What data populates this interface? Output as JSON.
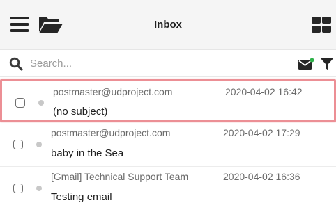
{
  "header": {
    "title": "Inbox",
    "menu_icon": "hamburger-menu-icon",
    "folder_icon": "folder-open-icon",
    "layout_icon": "grid-view-icon"
  },
  "search": {
    "placeholder": "Search...",
    "value": "",
    "search_icon": "search-icon",
    "mail_icon": "mail-unread-icon",
    "filter_icon": "filter-icon"
  },
  "messages": [
    {
      "sender": "postmaster@udproject.com",
      "date": "2020-04-02 16:42",
      "subject": "(no subject)",
      "highlighted": true
    },
    {
      "sender": "postmaster@udproject.com",
      "date": "2020-04-02 17:29",
      "subject": "baby in the Sea",
      "highlighted": false
    },
    {
      "sender": "[Gmail] Technical Support Team",
      "date": "2020-04-02 16:36",
      "subject": "Testing email",
      "highlighted": false
    }
  ],
  "colors": {
    "highlight_border": "#ec8f95",
    "unread_dot": "#c8c8c8",
    "new_mail_badge": "#2fb24a",
    "header_bg": "#f5f5f5"
  }
}
